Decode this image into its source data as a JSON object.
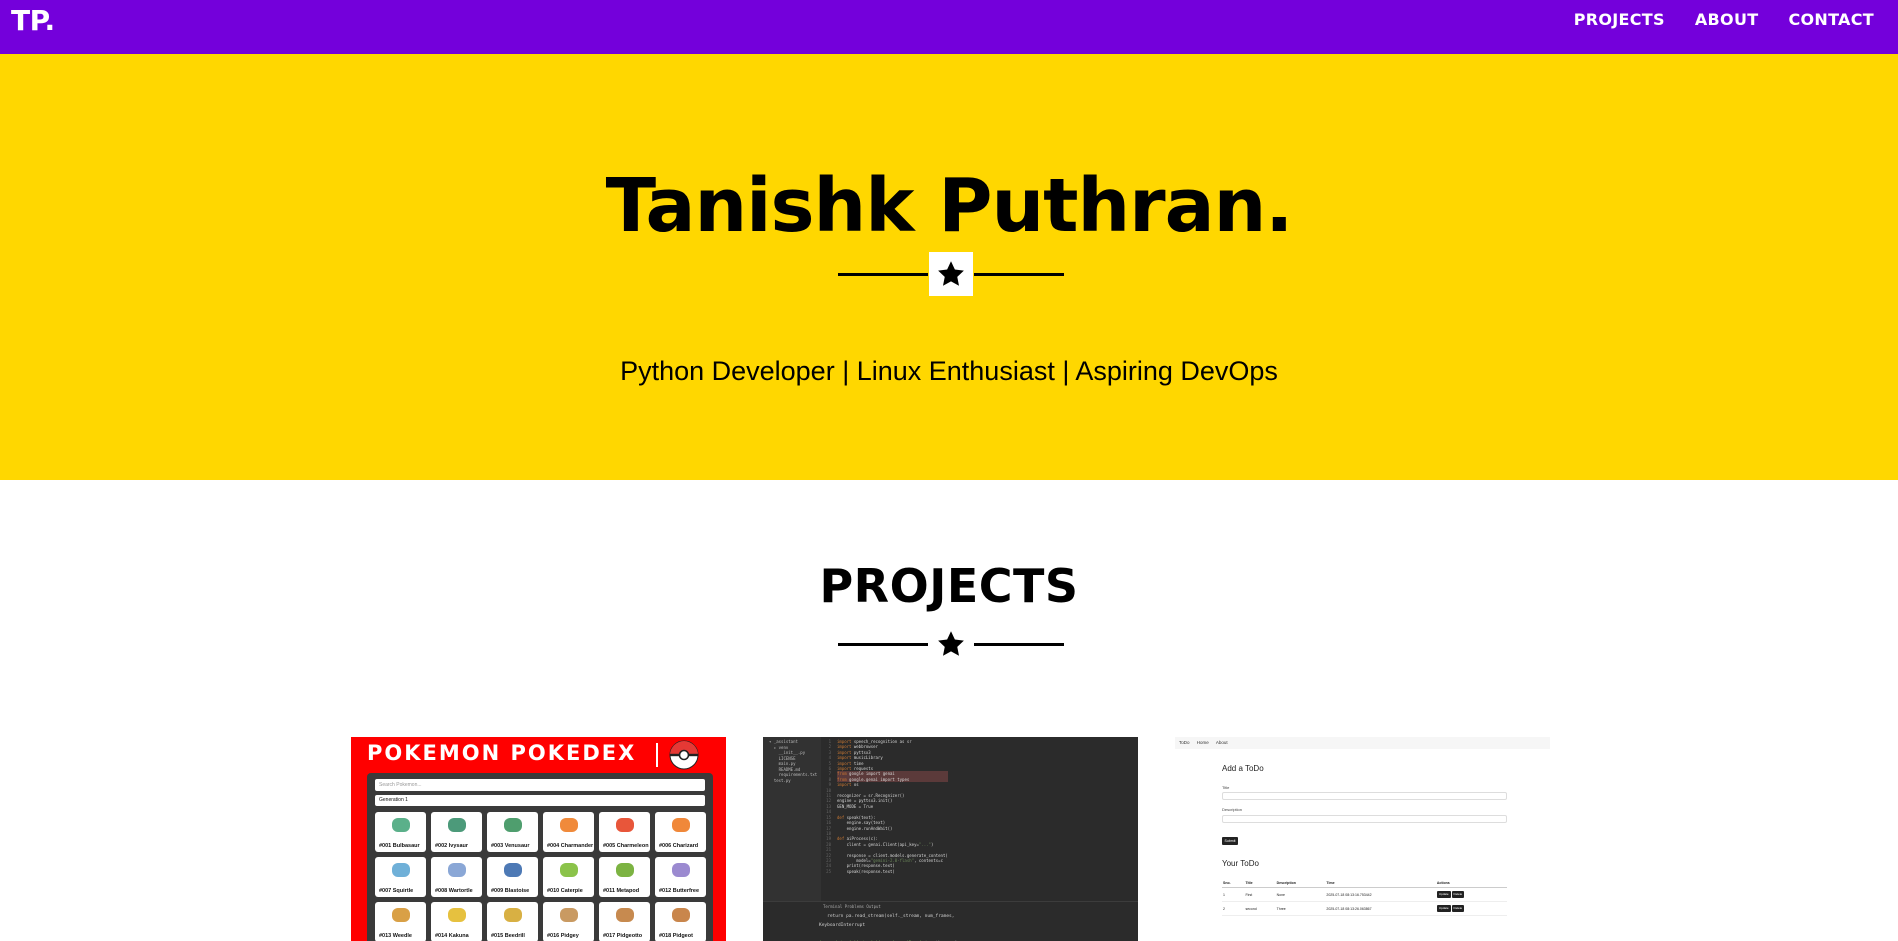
{
  "navbar": {
    "brand": "TP.",
    "links": [
      "PROJECTS",
      "ABOUT",
      "CONTACT"
    ]
  },
  "hero": {
    "name": "Tanishk Puthran.",
    "tagline": "Python Developer | Linux Enthusiast | Aspiring DevOps"
  },
  "projects": {
    "heading": "PROJECTS",
    "pokedex": {
      "title": "POKEMON POKEDEX",
      "search_placeholder": "Search Pokemon...",
      "generation": "Generation 1",
      "pokemon": [
        {
          "label": "#001 Bulbasaur",
          "color": "#5bb08a"
        },
        {
          "label": "#002 Ivysaur",
          "color": "#4c9a7a"
        },
        {
          "label": "#003 Venusaur",
          "color": "#4f9e6e"
        },
        {
          "label": "#004 Charmander",
          "color": "#f08a3b"
        },
        {
          "label": "#005 Charmeleon",
          "color": "#e8563a"
        },
        {
          "label": "#006 Charizard",
          "color": "#f0883a"
        },
        {
          "label": "#007 Squirtle",
          "color": "#6fb0d8"
        },
        {
          "label": "#008 Wartortle",
          "color": "#8aa7d6"
        },
        {
          "label": "#009 Blastoise",
          "color": "#4d79b5"
        },
        {
          "label": "#010 Caterpie",
          "color": "#8bc34a"
        },
        {
          "label": "#011 Metapod",
          "color": "#7cb342"
        },
        {
          "label": "#012 Butterfree",
          "color": "#9b8ad0"
        },
        {
          "label": "#013 Weedle",
          "color": "#d9a046"
        },
        {
          "label": "#014 Kakuna",
          "color": "#e6c13f"
        },
        {
          "label": "#015 Beedrill",
          "color": "#d8b043"
        },
        {
          "label": "#016 Pidgey",
          "color": "#c99a62"
        },
        {
          "label": "#017 Pidgeotto",
          "color": "#c78a4f"
        },
        {
          "label": "#018 Pidgeot",
          "color": "#c9864c"
        }
      ]
    },
    "editor": {
      "tree": [
        "▾ _assistant",
        "  ▸ venv",
        "    __init__.py",
        "    LICENSE",
        "    main.py",
        "    README.md",
        "    requirements.txt",
        "  test.py"
      ],
      "lines": [
        "import speech_recognition as sr",
        "import webbrowser",
        "import pyttsx3",
        "import musicLibrary",
        "import time",
        "import requests",
        "from google import genai",
        "from google.genai import types",
        "import os",
        "",
        "recognizer = sr.Recognizer()",
        "engine = pyttsx3.init()",
        "GEN_MODE = True",
        "",
        "def speak(text):",
        "    engine.say(text)",
        "    engine.runAndWait()",
        "",
        "def aiProcess(c):",
        "    client = genai.Client(api_key=\"...\")",
        "",
        "    response = client.models.generate_content(",
        "        model=\"gemini-2.0-flash\", contents=c",
        "    print(response.text)",
        "    speak(response.text)"
      ],
      "terminal_tabs": "Terminal    Problems    Output",
      "terminal": [
        "   return pa.read_stream(self._stream, num_frames,",
        "KeyboardInterrupt",
        "",
        "(.venv) tanishk@tanishk-aspire:~/Jarvis$ python main.py"
      ]
    },
    "todo": {
      "nav": [
        "ToDo",
        "Home",
        "About"
      ],
      "heading": "Add a ToDo",
      "title_label": "Title",
      "desc_label": "Description",
      "submit": "Submit",
      "list_heading": "Your ToDo",
      "columns": [
        "Sno.",
        "Title",
        "Description",
        "Time",
        "Actions"
      ],
      "rows": [
        {
          "sno": "1",
          "title": "First",
          "desc": "None",
          "time": "2025-07-18 08:13:16.753442"
        },
        {
          "sno": "2",
          "title": "second",
          "desc": "Three",
          "time": "2025-07-18 08:13:26.063867"
        }
      ],
      "update_label": "Update",
      "delete_label": "Delete"
    }
  }
}
